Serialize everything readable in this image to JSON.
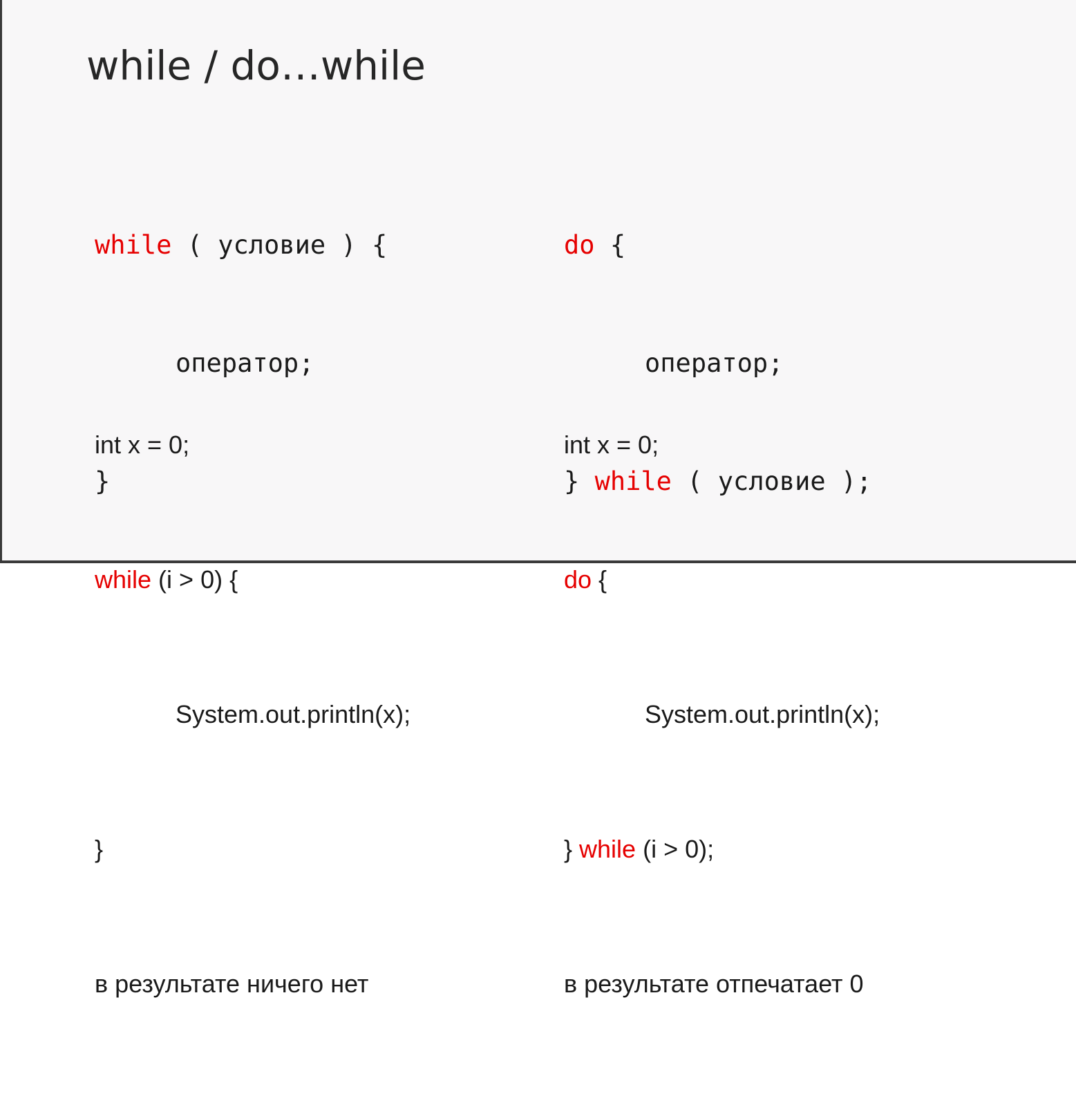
{
  "slide": {
    "title": "while / do…while",
    "syntax_left": {
      "line1_kw": "while",
      "line1_rest": " ( условие ) {",
      "line2": "оператор;",
      "line3": "}"
    },
    "syntax_right": {
      "line1_kw": "do",
      "line1_rest": " {",
      "line2": "оператор;",
      "line3_start": "} ",
      "line3_kw": "while",
      "line3_rest": " ( условие );"
    },
    "example_left": {
      "line1": "int x = 0;",
      "line2_kw": "while",
      "line2_rest": " (i > 0) {",
      "line3": "System.out.println(x);",
      "line4": "}",
      "result": "в результате ничего нет"
    },
    "example_right": {
      "line1": "int x = 0;",
      "line2_kw": "do",
      "line2_rest": " {",
      "line3": "System.out.println(x);",
      "line4_start": "} ",
      "line4_kw": "while",
      "line4_rest": " (i > 0);",
      "result": "в результате отпечатает 0"
    }
  },
  "colors": {
    "keyword": "#e60000",
    "text": "#1a1a1a",
    "title": "#262626",
    "background": "#f8f7f8"
  }
}
